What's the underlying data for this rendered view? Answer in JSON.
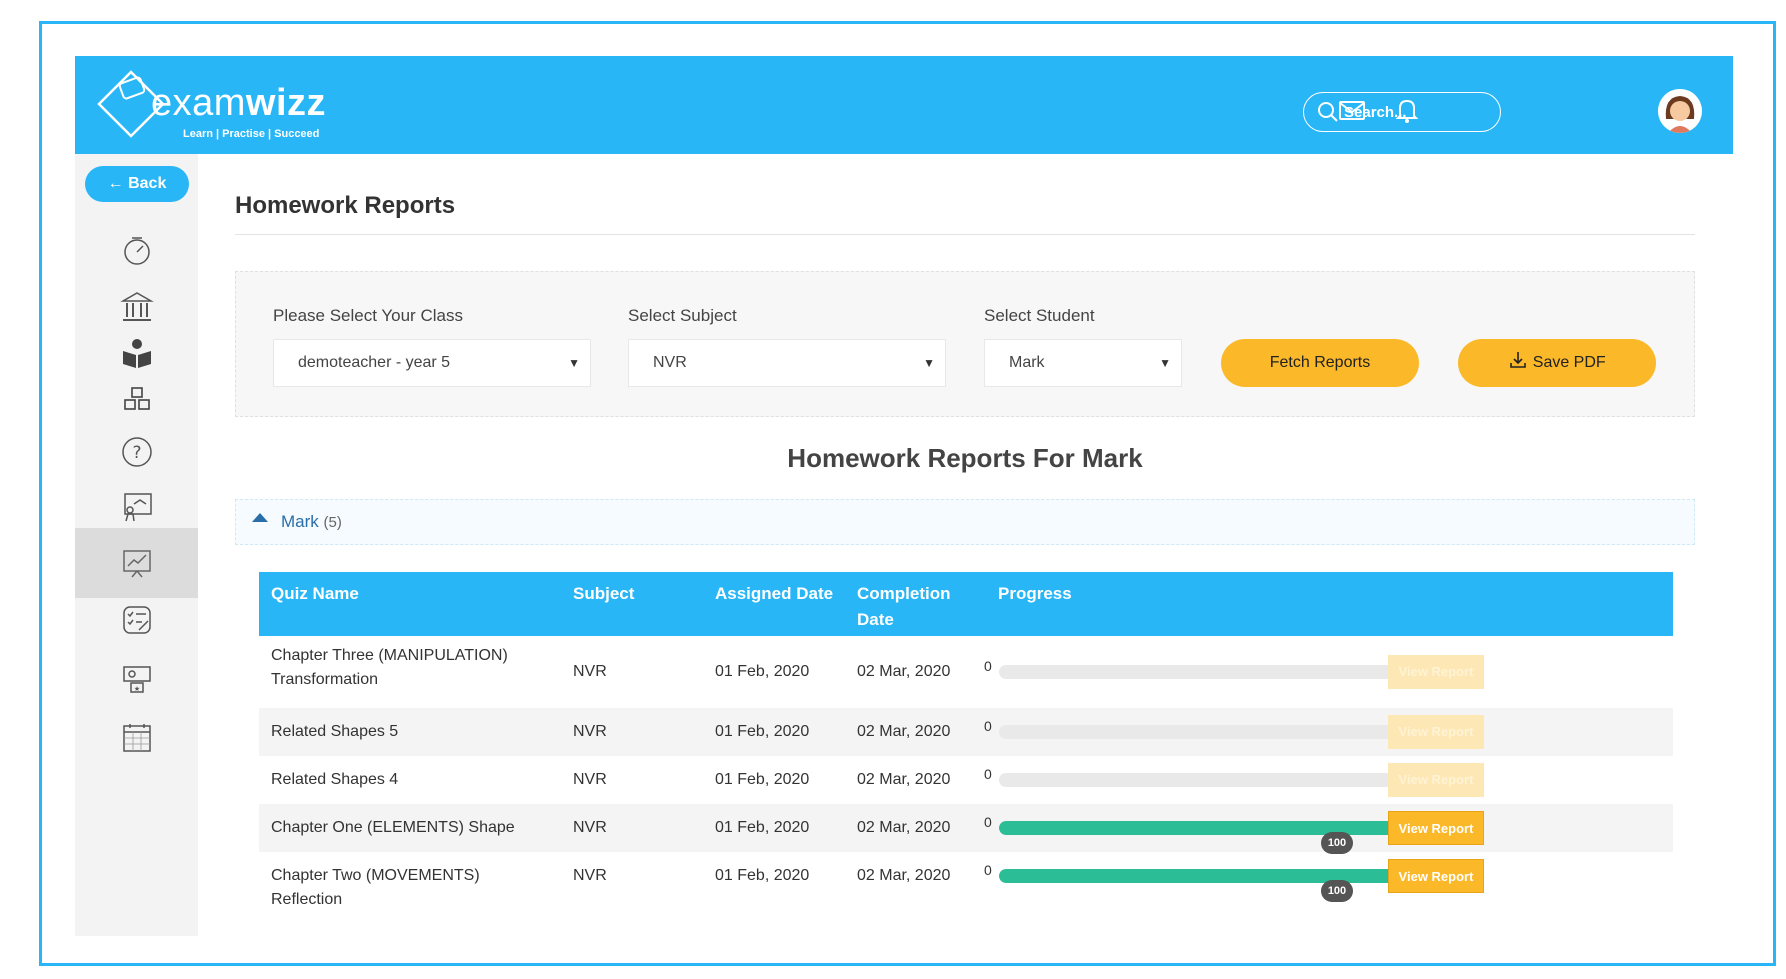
{
  "brand": {
    "name_light": "exam",
    "name_bold": "wizz",
    "tagline": "Learn | Practise | Succeed"
  },
  "search": {
    "placeholder": "Search..."
  },
  "sidebar": {
    "back_label": "← Back",
    "items": [
      {
        "icon": "speedometer-icon"
      },
      {
        "icon": "institution-icon"
      },
      {
        "icon": "reader-icon"
      },
      {
        "icon": "cubes-icon"
      },
      {
        "icon": "question-icon"
      },
      {
        "icon": "presentation-icon"
      },
      {
        "icon": "chart-board-icon",
        "active": true
      },
      {
        "icon": "checklist-icon"
      },
      {
        "icon": "award-board-icon"
      },
      {
        "icon": "calendar-icon"
      }
    ]
  },
  "page": {
    "title": "Homework Reports"
  },
  "filters": {
    "class_label": "Please Select Your Class",
    "class_value": "demoteacher - year 5",
    "subject_label": "Select Subject",
    "subject_value": "NVR",
    "student_label": "Select Student",
    "student_value": "Mark",
    "fetch_label": "Fetch Reports",
    "save_label": "Save PDF"
  },
  "reports": {
    "heading": "Homework Reports For Mark",
    "group_name": "Mark",
    "group_count": "(5)",
    "columns": {
      "quiz": "Quiz Name",
      "subject": "Subject",
      "assigned": "Assigned Date",
      "completion": "Completion Date",
      "progress": "Progress"
    },
    "view_label": "View Report",
    "rows": [
      {
        "quiz": "Chapter Three (MANIPULATION) Transformation",
        "subject": "NVR",
        "assigned": "01 Feb, 2020",
        "completion": "02 Mar, 2020",
        "progress_min": "0",
        "progress": 0,
        "progress_label": "",
        "view_enabled": false
      },
      {
        "quiz": "Related Shapes 5",
        "subject": "NVR",
        "assigned": "01 Feb, 2020",
        "completion": "02 Mar, 2020",
        "progress_min": "0",
        "progress": 0,
        "progress_label": "",
        "view_enabled": false
      },
      {
        "quiz": "Related Shapes 4",
        "subject": "NVR",
        "assigned": "01 Feb, 2020",
        "completion": "02 Mar, 2020",
        "progress_min": "0",
        "progress": 0,
        "progress_label": "",
        "view_enabled": false
      },
      {
        "quiz": "Chapter One (ELEMENTS) Shape",
        "subject": "NVR",
        "assigned": "01 Feb, 2020",
        "completion": "02 Mar, 2020",
        "progress_min": "0",
        "progress": 100,
        "progress_label": "100",
        "view_enabled": true
      },
      {
        "quiz": "Chapter Two (MOVEMENTS) Reflection",
        "subject": "NVR",
        "assigned": "01 Feb, 2020",
        "completion": "02 Mar, 2020",
        "progress_min": "0",
        "progress": 100,
        "progress_label": "100",
        "view_enabled": true
      }
    ]
  },
  "colors": {
    "primary": "#29b6f6",
    "accent": "#fbb829",
    "progress": "#2bbd96"
  }
}
